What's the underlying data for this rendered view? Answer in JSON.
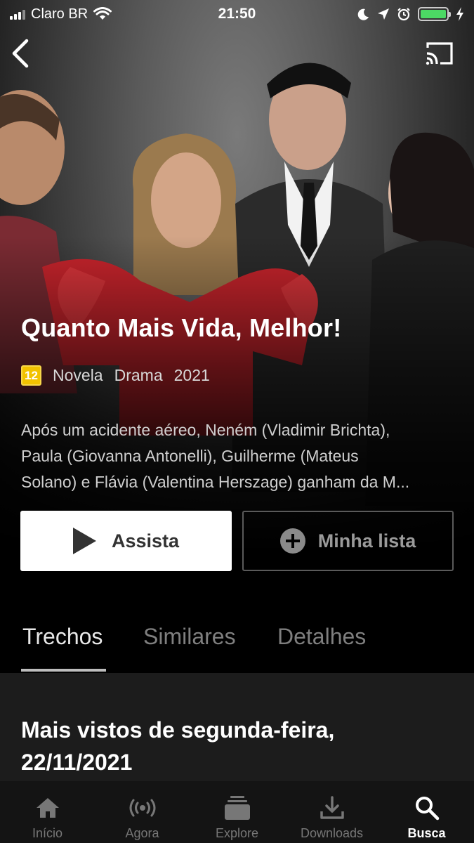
{
  "status_bar": {
    "carrier": "Claro BR",
    "time": "21:50"
  },
  "show": {
    "title": "Quanto Mais Vida, Melhor!",
    "rating": "12",
    "genres": [
      "Novela",
      "Drama"
    ],
    "year": "2021",
    "synopsis_lines": [
      "Após um acidente aéreo, Neném (Vladimir Brichta),",
      "Paula (Giovanna Antonelli), Guilherme (Mateus",
      "Solano) e Flávia (Valentina Herszage) ganham da M..."
    ]
  },
  "actions": {
    "watch_label": "Assista",
    "list_label": "Minha lista"
  },
  "tabs": [
    {
      "label": "Trechos",
      "active": true
    },
    {
      "label": "Similares",
      "active": false
    },
    {
      "label": "Detalhes",
      "active": false
    }
  ],
  "section": {
    "title_line1": "Mais vistos de segunda-feira,",
    "title_line2": "22/11/2021"
  },
  "bottom_nav": [
    {
      "label": "Início",
      "icon": "home-icon",
      "active": false
    },
    {
      "label": "Agora",
      "icon": "broadcast-icon",
      "active": false
    },
    {
      "label": "Explore",
      "icon": "stack-icon",
      "active": false
    },
    {
      "label": "Downloads",
      "icon": "download-icon",
      "active": false
    },
    {
      "label": "Busca",
      "icon": "search-icon",
      "active": true
    }
  ],
  "colors": {
    "rating_badge": "#f2c200",
    "battery": "#4cd964",
    "background": "#000000"
  }
}
